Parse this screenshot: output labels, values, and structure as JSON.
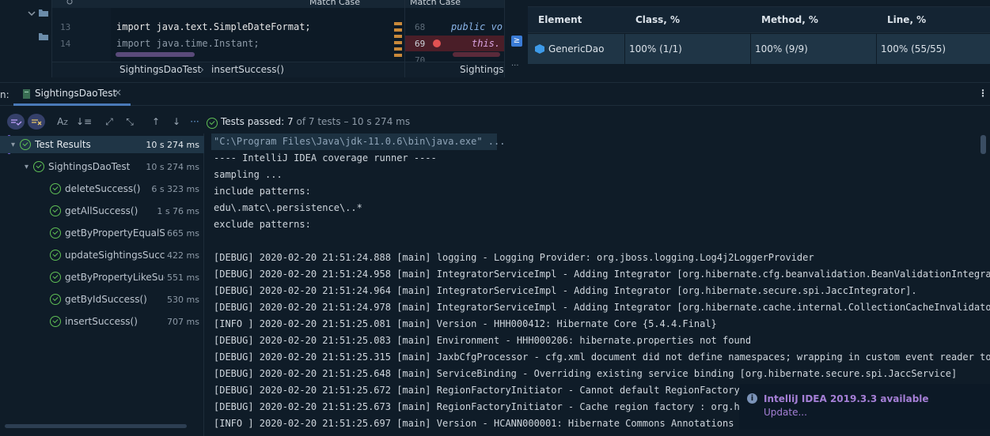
{
  "editor_main": {
    "line_numbers": [
      "13",
      "14"
    ],
    "code_lines": [
      "import java.text.SimpleDateFormat;",
      "import java.time.Instant;"
    ],
    "search_label": "Match Case",
    "breadcrumb": [
      "SightingsDaoTest",
      "insertSuccess()"
    ]
  },
  "editor_second": {
    "search_label": "Match Case",
    "line_numbers": [
      "68",
      "69",
      "70"
    ],
    "code_lines": [
      "public vo",
      "this.",
      ""
    ],
    "breadcrumb": "Sightings"
  },
  "coverage": {
    "headers": [
      "Element",
      "Class, %",
      "Method, %",
      "Line, %"
    ],
    "rows": [
      {
        "element": "GenericDao",
        "class": "100% (1/1)",
        "method": "100% (9/9)",
        "line": "100% (55/55)"
      }
    ]
  },
  "run_panel": {
    "prefix": "n:",
    "tab_label": "SightingsDaoTest",
    "status_prefix": "Tests passed:",
    "status_count": "7",
    "status_suffix": "of 7 tests – 10 s 274 ms"
  },
  "tree": [
    {
      "label": "Test Results",
      "duration": "10 s 274 ms",
      "level": 0
    },
    {
      "label": "SightingsDaoTest",
      "duration": "10 s 274 ms",
      "level": 1
    },
    {
      "label": "deleteSuccess()",
      "duration": "6 s 323 ms",
      "level": 2
    },
    {
      "label": "getAllSuccess()",
      "duration": "1 s 76 ms",
      "level": 2
    },
    {
      "label": "getByPropertyEqualSuccess()",
      "duration": "665 ms",
      "level": 2
    },
    {
      "label": "updateSightingsSuccess()",
      "duration": "422 ms",
      "level": 2
    },
    {
      "label": "getByPropertyLikeSuccess()",
      "duration": "551 ms",
      "level": 2
    },
    {
      "label": "getByIdSuccess()",
      "duration": "530 ms",
      "level": 2
    },
    {
      "label": "insertSuccess()",
      "duration": "707 ms",
      "level": 2
    }
  ],
  "console": [
    "\"C:\\Program Files\\Java\\jdk-11.0.6\\bin\\java.exe\" ...",
    "---- IntelliJ IDEA coverage runner ----",
    "sampling ...",
    "include patterns:",
    "edu\\.matc\\.persistence\\..*",
    "exclude patterns:",
    "",
    "[DEBUG] 2020-02-20 21:51:24.888 [main] logging - Logging Provider: org.jboss.logging.Log4j2LoggerProvider",
    "[DEBUG] 2020-02-20 21:51:24.958 [main] IntegratorServiceImpl - Adding Integrator [org.hibernate.cfg.beanvalidation.BeanValidationIntegrator",
    "[DEBUG] 2020-02-20 21:51:24.964 [main] IntegratorServiceImpl - Adding Integrator [org.hibernate.secure.spi.JaccIntegrator].",
    "[DEBUG] 2020-02-20 21:51:24.978 [main] IntegratorServiceImpl - Adding Integrator [org.hibernate.cache.internal.CollectionCacheInvalidator].",
    "[INFO ] 2020-02-20 21:51:25.081 [main] Version - HHH000412: Hibernate Core {5.4.4.Final}",
    "[DEBUG] 2020-02-20 21:51:25.083 [main] Environment - HHH000206: hibernate.properties not found",
    "[DEBUG] 2020-02-20 21:51:25.315 [main] JaxbCfgProcessor - cfg.xml document did not define namespaces; wrapping in custom event reader to ir",
    "[DEBUG] 2020-02-20 21:51:25.648 [main] ServiceBinding - Overriding existing service binding [org.hibernate.secure.spi.JaccService]",
    "[DEBUG] 2020-02-20 21:51:25.672 [main] RegionFactoryInitiator - Cannot default RegionFactory based on registered strategies as `[]` Region",
    "[DEBUG] 2020-02-20 21:51:25.673 [main] RegionFactoryInitiator - Cache region factory : org.hibernate.cache.internal.NoCachingRegionFactory",
    "[INFO ] 2020-02-20 21:51:25.697 [main] Version - HCANN000001: Hibernate Commons Annotations {5.1.0.Final}"
  ],
  "notification": {
    "title": "IntelliJ IDEA 2019.3.3 available",
    "link": "Update..."
  },
  "colors": {
    "background": "#0f1c28",
    "pass_green": "#5fbf55",
    "selection": "#1f3546",
    "notification_purple": "#a57fd6"
  }
}
